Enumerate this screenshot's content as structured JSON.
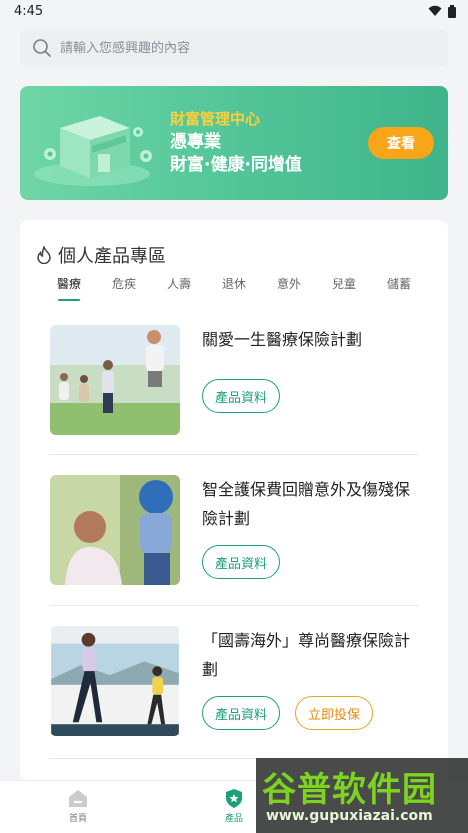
{
  "status_bar": {
    "time": "4:45",
    "icons": [
      "wifi-icon",
      "battery-icon"
    ]
  },
  "search": {
    "placeholder": "請輸入您感興趣的內容"
  },
  "banner": {
    "kicker": "財富管理中心",
    "line1": "憑專業",
    "line2": "財富·健康·同增值",
    "button_label": "查看"
  },
  "section": {
    "title": "個人產品專區",
    "tabs": [
      {
        "label": "醫療",
        "active": true
      },
      {
        "label": "危疾"
      },
      {
        "label": "人壽"
      },
      {
        "label": "退休"
      },
      {
        "label": "意外"
      },
      {
        "label": "兒童"
      },
      {
        "label": "儲蓄"
      }
    ]
  },
  "products": [
    {
      "name": "關愛一生醫療保險計劃",
      "buttons": [
        "產品資料"
      ]
    },
    {
      "name": "智全護保費回贈意外及傷殘保險計劃",
      "buttons": [
        "產品資料"
      ]
    },
    {
      "name": "「國壽海外」尊尚醫療保險計劃",
      "buttons": [
        "產品資料",
        "立即投保"
      ]
    }
  ],
  "bottom_nav": [
    {
      "label": "首頁",
      "icon": "home-icon"
    },
    {
      "label": "產品",
      "icon": "shield-star-icon",
      "active": true
    }
  ],
  "watermark": {
    "brand": "谷普软件园",
    "url": "www.gupuxiazai.com"
  },
  "colors": {
    "accent": "#1f9e7a",
    "banner_button": "#f8a51a",
    "kicker": "#ffcf3a"
  }
}
